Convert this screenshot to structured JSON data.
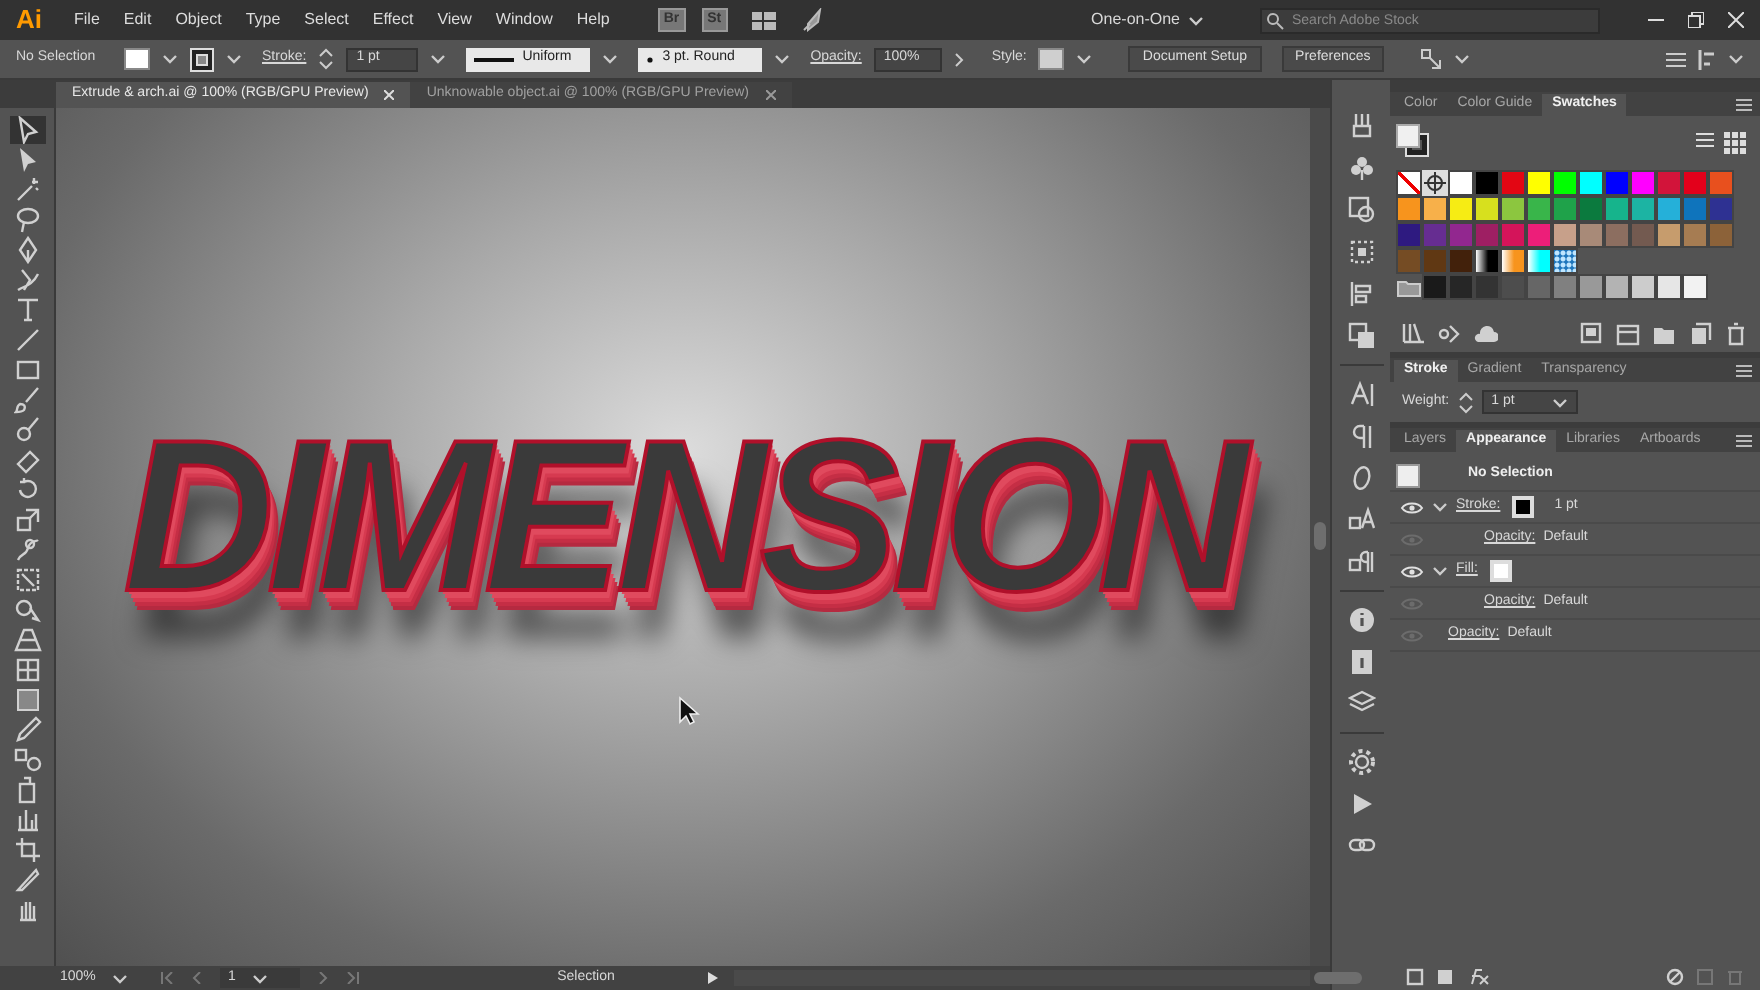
{
  "app_logo": "Ai",
  "menu": [
    "File",
    "Edit",
    "Object",
    "Type",
    "Select",
    "Effect",
    "View",
    "Window",
    "Help"
  ],
  "bridge_buttons": [
    "Br",
    "St"
  ],
  "workspace": "One-on-One",
  "stock_search": {
    "placeholder": "Search Adobe Stock"
  },
  "control_bar": {
    "selection": "No Selection",
    "stroke_label": "Stroke:",
    "stroke_weight": "1 pt",
    "profile": "Uniform",
    "brush": "3 pt. Round",
    "opacity_label": "Opacity:",
    "opacity": "100%",
    "style_label": "Style:",
    "buttons": [
      "Document Setup",
      "Preferences"
    ]
  },
  "document_tabs": [
    {
      "label": "Extrude & arch.ai @ 100% (RGB/GPU Preview)",
      "selected": true
    },
    {
      "label": "Unknowable object.ai @ 100% (RGB/GPU Preview)",
      "selected": false
    }
  ],
  "artwork_text": "DIMENSION",
  "swatches_panel": {
    "tabs": [
      {
        "label": "Color",
        "selected": false
      },
      {
        "label": "Color Guide",
        "selected": false
      },
      {
        "label": "Swatches",
        "selected": true
      }
    ],
    "rows": [
      [
        {
          "kind": "none"
        },
        {
          "kind": "registration"
        },
        {
          "kind": "solid",
          "color": "#ffffff"
        },
        {
          "kind": "solid",
          "color": "#000000"
        },
        {
          "kind": "solid",
          "color": "#e30613"
        },
        {
          "kind": "solid",
          "color": "#ffff00"
        },
        {
          "kind": "solid",
          "color": "#00ff00"
        },
        {
          "kind": "solid",
          "color": "#00ffff"
        },
        {
          "kind": "solid",
          "color": "#0000ff"
        },
        {
          "kind": "solid",
          "color": "#ff00ff"
        },
        {
          "kind": "solid",
          "color": "#d2143a"
        },
        {
          "kind": "solid",
          "color": "#e3001b"
        },
        {
          "kind": "solid",
          "color": "#e8501e"
        }
      ],
      [
        {
          "kind": "solid",
          "color": "#f7941d"
        },
        {
          "kind": "solid",
          "color": "#f7b04a"
        },
        {
          "kind": "solid",
          "color": "#f6ec14"
        },
        {
          "kind": "solid",
          "color": "#d7e01e"
        },
        {
          "kind": "solid",
          "color": "#8cc63f"
        },
        {
          "kind": "solid",
          "color": "#39b54a"
        },
        {
          "kind": "solid",
          "color": "#1fa24a"
        },
        {
          "kind": "solid",
          "color": "#0b7a3e"
        },
        {
          "kind": "solid",
          "color": "#16b48c"
        },
        {
          "kind": "solid",
          "color": "#1cb4a3"
        },
        {
          "kind": "solid",
          "color": "#25b0d9"
        },
        {
          "kind": "solid",
          "color": "#0f74bc"
        },
        {
          "kind": "solid",
          "color": "#2e3192"
        }
      ],
      [
        {
          "kind": "solid",
          "color": "#2e1a80"
        },
        {
          "kind": "solid",
          "color": "#662d91"
        },
        {
          "kind": "solid",
          "color": "#92278f"
        },
        {
          "kind": "solid",
          "color": "#9e1f63"
        },
        {
          "kind": "solid",
          "color": "#d4145a"
        },
        {
          "kind": "solid",
          "color": "#ed1e79"
        },
        {
          "kind": "solid",
          "color": "#c7a08a"
        },
        {
          "kind": "solid",
          "color": "#a88a78"
        },
        {
          "kind": "solid",
          "color": "#8c6e60"
        },
        {
          "kind": "solid",
          "color": "#735a50"
        },
        {
          "kind": "solid",
          "color": "#c69c6d"
        },
        {
          "kind": "solid",
          "color": "#a67c52"
        },
        {
          "kind": "solid",
          "color": "#8c6239"
        }
      ],
      [
        {
          "kind": "solid",
          "color": "#754c24"
        },
        {
          "kind": "solid",
          "color": "#603813"
        },
        {
          "kind": "solid",
          "color": "#42210b"
        },
        {
          "kind": "gradient",
          "color": "#000000"
        },
        {
          "kind": "gradient",
          "color": "#f7941d"
        },
        {
          "kind": "gradient",
          "color": "#00ffff"
        },
        {
          "kind": "pattern",
          "color": "#1c75bc"
        }
      ],
      [
        {
          "kind": "group"
        },
        {
          "kind": "solid",
          "color": "#1a1a1a"
        },
        {
          "kind": "solid",
          "color": "#262626"
        },
        {
          "kind": "solid",
          "color": "#333333"
        },
        {
          "kind": "solid",
          "color": "#4d4d4d"
        },
        {
          "kind": "solid",
          "color": "#666666"
        },
        {
          "kind": "solid",
          "color": "#808080"
        },
        {
          "kind": "solid",
          "color": "#999999"
        },
        {
          "kind": "solid",
          "color": "#b3b3b3"
        },
        {
          "kind": "solid",
          "color": "#cccccc"
        },
        {
          "kind": "solid",
          "color": "#e6e6e6"
        },
        {
          "kind": "solid",
          "color": "#f2f2f2"
        }
      ]
    ]
  },
  "stroke_panel": {
    "tabs": [
      {
        "label": "Stroke",
        "selected": true
      },
      {
        "label": "Gradient",
        "selected": false
      },
      {
        "label": "Transparency",
        "selected": false
      }
    ],
    "weight_label": "Weight:",
    "weight": "1 pt"
  },
  "appearance_panel": {
    "tabs": [
      {
        "label": "Layers",
        "selected": false
      },
      {
        "label": "Appearance",
        "selected": true
      },
      {
        "label": "Libraries",
        "selected": false
      },
      {
        "label": "Artboards",
        "selected": false
      }
    ],
    "title": "No Selection",
    "rows": [
      {
        "label": "Stroke:",
        "color": "#000000",
        "value": "1 pt",
        "children": [
          {
            "label": "Opacity:",
            "value": "Default"
          }
        ]
      },
      {
        "label": "Fill:",
        "color": "#ffffff",
        "children": [
          {
            "label": "Opacity:",
            "value": "Default"
          }
        ]
      },
      {
        "label": "Opacity:",
        "value": "Default"
      }
    ]
  },
  "status_bar": {
    "zoom": "100%",
    "artboard": "1",
    "tool": "Selection"
  }
}
